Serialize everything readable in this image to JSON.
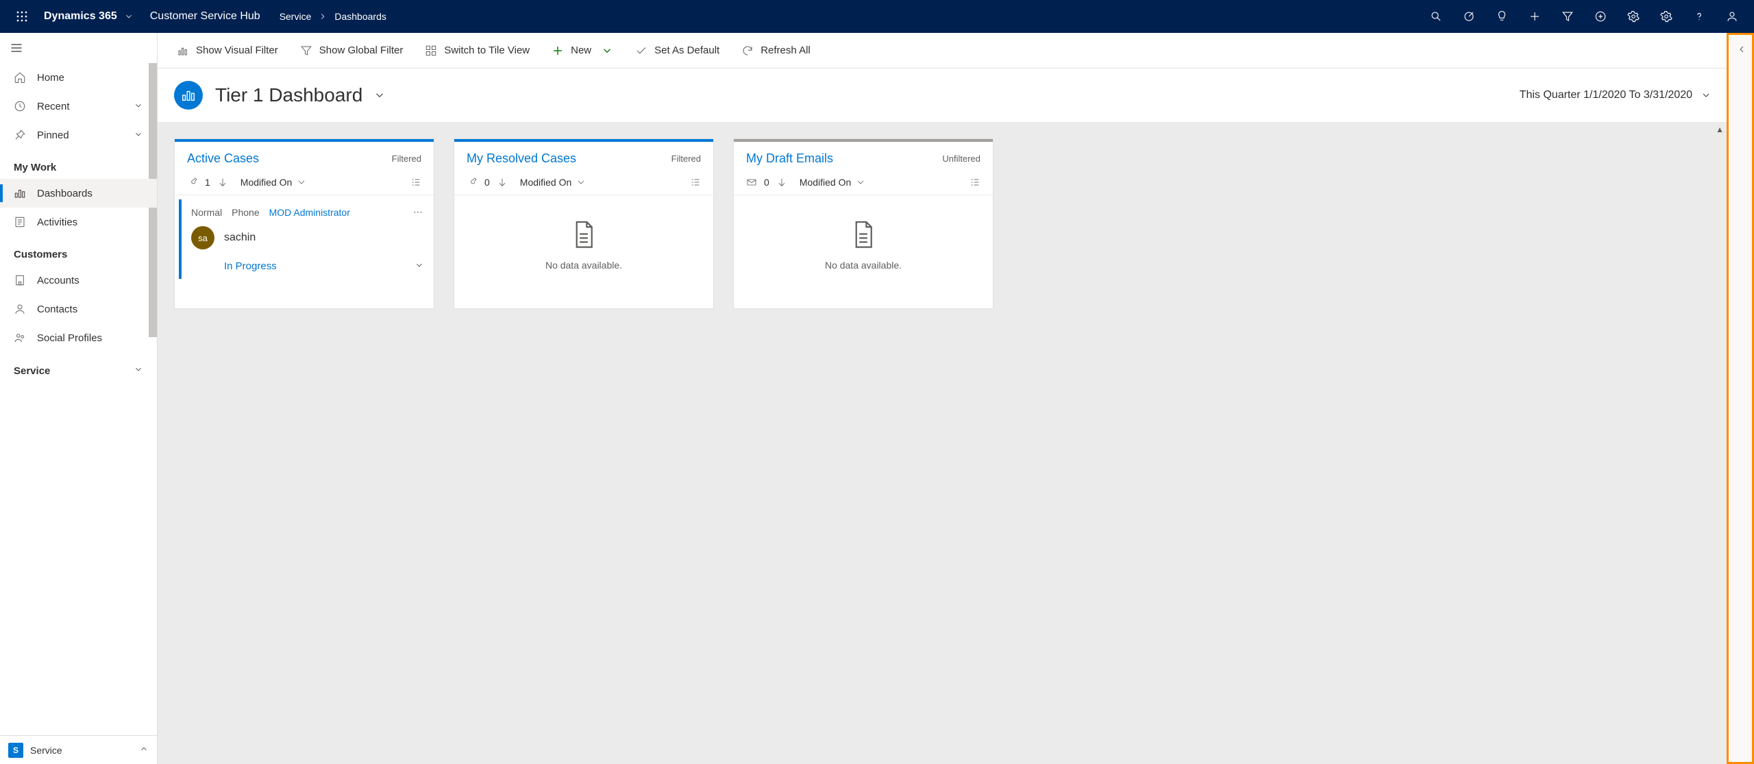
{
  "topbar": {
    "brand": "Dynamics 365",
    "app": "Customer Service Hub",
    "breadcrumb": {
      "area": "Service",
      "page": "Dashboards"
    }
  },
  "sidebar": {
    "home": "Home",
    "recent": "Recent",
    "pinned": "Pinned",
    "groups": [
      {
        "label": "My Work",
        "items": [
          {
            "label": "Dashboards",
            "selected": true
          },
          {
            "label": "Activities"
          }
        ]
      },
      {
        "label": "Customers",
        "items": [
          {
            "label": "Accounts"
          },
          {
            "label": "Contacts"
          },
          {
            "label": "Social Profiles"
          }
        ]
      },
      {
        "label": "Service",
        "items": []
      }
    ],
    "area_switcher": {
      "initial": "S",
      "label": "Service"
    }
  },
  "commandbar": {
    "visual_filter": "Show Visual Filter",
    "global_filter": "Show Global Filter",
    "tile_view": "Switch to Tile View",
    "new": "New",
    "set_default": "Set As Default",
    "refresh_all": "Refresh All"
  },
  "dashboard": {
    "title": "Tier 1 Dashboard",
    "date_range": "This Quarter 1/1/2020 To 3/31/2020"
  },
  "cards": [
    {
      "title": "Active Cases",
      "accent": "blue",
      "filter_state": "Filtered",
      "count": "1",
      "sort_column": "Modified On",
      "icon": "wrench",
      "record": {
        "priority": "Normal",
        "channel": "Phone",
        "owner": "MOD Administrator",
        "avatar_initials": "sa",
        "name": "sachin",
        "status": "In Progress"
      }
    },
    {
      "title": "My Resolved Cases",
      "accent": "blue",
      "filter_state": "Filtered",
      "count": "0",
      "sort_column": "Modified On",
      "icon": "wrench",
      "empty_text": "No data available."
    },
    {
      "title": "My Draft Emails",
      "accent": "gray",
      "filter_state": "Unfiltered",
      "count": "0",
      "sort_column": "Modified On",
      "icon": "mail",
      "empty_text": "No data available."
    }
  ]
}
